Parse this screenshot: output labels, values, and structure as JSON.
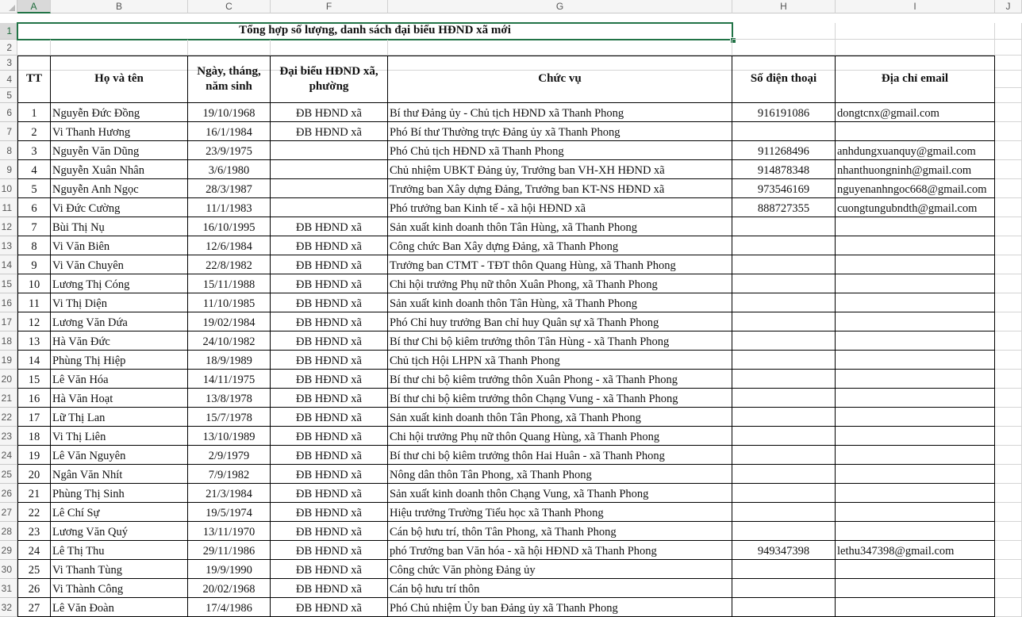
{
  "sheet": {
    "column_headers": [
      "A",
      "B",
      "C",
      "F",
      "G",
      "H",
      "I",
      "J"
    ],
    "selected_column": "A",
    "title": "Tổng hợp số lượng, danh sách đại biểu HĐND xã mới",
    "headers": {
      "tt": "TT",
      "name": "Họ và tên",
      "dob": "Ngày, tháng, năm sinh",
      "delegate": "Đại biểu HĐND xã, phường",
      "position": "Chức vụ",
      "phone": "Số điện thoại",
      "email": "Địa chỉ email"
    },
    "rows": [
      {
        "row": "6",
        "tt": "1",
        "name": "Nguyễn Đức Đồng",
        "dob": "19/10/1968",
        "delegate": "ĐB HĐND xã",
        "position": "Bí thư Đảng ủy - Chủ tịch HĐND xã Thanh Phong",
        "phone": "916191086",
        "email": "dongtcnx@gmail.com"
      },
      {
        "row": "7",
        "tt": "2",
        "name": "Vi Thanh Hương",
        "dob": "16/1/1984",
        "delegate": "ĐB HĐND xã",
        "position": "Phó Bí thư Thường trực Đảng ủy xã Thanh Phong",
        "phone": "",
        "email": ""
      },
      {
        "row": "8",
        "tt": "3",
        "name": "Nguyễn Văn Dũng",
        "dob": "23/9/1975",
        "delegate": "",
        "position": "Phó Chủ tịch HĐND xã Thanh Phong",
        "phone": "911268496",
        "email": "anhdungxuanquy@gmail.com"
      },
      {
        "row": "9",
        "tt": "4",
        "name": "Nguyễn Xuân Nhân",
        "dob": "3/6/1980",
        "delegate": "",
        "position": "Chủ nhiệm UBKT Đảng ủy, Trưởng ban VH-XH HĐND xã",
        "phone": "914878348",
        "email": "nhanthuongninh@gmail.com"
      },
      {
        "row": "10",
        "tt": "5",
        "name": "Nguyễn Anh Ngọc",
        "dob": "28/3/1987",
        "delegate": "",
        "position": "Trưởng ban Xây dựng Đảng, Trưởng ban KT-NS HĐND xã",
        "phone": "973546169",
        "email": "nguyenanhngoc668@gmail.com"
      },
      {
        "row": "11",
        "tt": "6",
        "name": "Vi Đức Cường",
        "dob": "11/1/1983",
        "delegate": "",
        "position": "Phó trưởng ban Kinh tế - xã hội HĐND xã",
        "phone": "888727355",
        "email": "cuongtungubndth@gmail.com"
      },
      {
        "row": "12",
        "tt": "7",
        "name": "Bùi Thị Nụ",
        "dob": "16/10/1995",
        "delegate": "ĐB HĐND xã",
        "position": "Sản xuất kinh doanh thôn Tân Hùng, xã Thanh Phong",
        "phone": "",
        "email": ""
      },
      {
        "row": "13",
        "tt": "8",
        "name": "Vi Văn Biên",
        "dob": "12/6/1984",
        "delegate": "ĐB HĐND xã",
        "position": "Công chức Ban Xây dựng Đảng, xã Thanh Phong",
        "phone": "",
        "email": ""
      },
      {
        "row": "14",
        "tt": "9",
        "name": "Vi Văn Chuyên",
        "dob": "22/8/1982",
        "delegate": "ĐB HĐND xã",
        "position": "Trưởng ban CTMT - TĐT thôn Quang Hùng, xã Thanh Phong",
        "phone": "",
        "email": ""
      },
      {
        "row": "15",
        "tt": "10",
        "name": "Lương Thị Cóng",
        "dob": "15/11/1988",
        "delegate": "ĐB HĐND xã",
        "position": "Chi hội trưởng Phụ nữ thôn Xuân Phong, xã Thanh Phong",
        "phone": "",
        "email": ""
      },
      {
        "row": "16",
        "tt": "11",
        "name": "Vi Thị Diện",
        "dob": "11/10/1985",
        "delegate": "ĐB HĐND xã",
        "position": "Sản xuất kinh doanh thôn Tân Hùng, xã Thanh Phong",
        "phone": "",
        "email": ""
      },
      {
        "row": "17",
        "tt": "12",
        "name": "Lương Văn Dứa",
        "dob": "19/02/1984",
        "delegate": "ĐB HĐND xã",
        "position": "Phó Chỉ huy trưởng Ban chỉ huy Quân sự xã Thanh Phong",
        "phone": "",
        "email": ""
      },
      {
        "row": "18",
        "tt": "13",
        "name": "Hà Văn Đức",
        "dob": "24/10/1982",
        "delegate": "ĐB HĐND xã",
        "position": "Bí thư Chi bộ kiêm trưởng thôn Tân Hùng - xã Thanh Phong",
        "phone": "",
        "email": ""
      },
      {
        "row": "19",
        "tt": "14",
        "name": "Phùng Thị Hiệp",
        "dob": "18/9/1989",
        "delegate": "ĐB HĐND xã",
        "position": "Chủ tịch Hội LHPN xã Thanh Phong",
        "phone": "",
        "email": ""
      },
      {
        "row": "20",
        "tt": "15",
        "name": "Lê Văn Hóa",
        "dob": "14/11/1975",
        "delegate": "ĐB HĐND xã",
        "position": "Bí thư chi bộ kiêm trưởng thôn Xuân Phong - xã Thanh Phong",
        "phone": "",
        "email": ""
      },
      {
        "row": "21",
        "tt": "16",
        "name": "Hà Văn Hoạt",
        "dob": "13/8/1978",
        "delegate": "ĐB HĐND xã",
        "position": "Bí thư chi bộ kiêm trưởng thôn Chạng Vung - xã Thanh Phong",
        "phone": "",
        "email": ""
      },
      {
        "row": "22",
        "tt": "17",
        "name": "Lữ Thị Lan",
        "dob": "15/7/1978",
        "delegate": "ĐB HĐND xã",
        "position": "Sản xuất kinh doanh thôn Tân Phong, xã Thanh Phong",
        "phone": "",
        "email": ""
      },
      {
        "row": "23",
        "tt": "18",
        "name": "Vi Thị Liên",
        "dob": "13/10/1989",
        "delegate": "ĐB HĐND xã",
        "position": "Chi hội trưởng Phụ nữ thôn Quang Hùng, xã Thanh Phong",
        "phone": "",
        "email": ""
      },
      {
        "row": "24",
        "tt": "19",
        "name": "Lê Văn Nguyên",
        "dob": "2/9/1979",
        "delegate": "ĐB HĐND xã",
        "position": "Bí thư chi bộ kiêm trưởng thôn Hai Huân - xã Thanh Phong",
        "phone": "",
        "email": ""
      },
      {
        "row": "25",
        "tt": "20",
        "name": "Ngân Văn Nhít",
        "dob": "7/9/1982",
        "delegate": "ĐB HĐND xã",
        "position": "Nông dân thôn Tân Phong, xã Thanh Phong",
        "phone": "",
        "email": ""
      },
      {
        "row": "26",
        "tt": "21",
        "name": "Phùng Thị Sinh",
        "dob": "21/3/1984",
        "delegate": "ĐB HĐND xã",
        "position": "Sản xuất kinh doanh thôn Chạng Vung, xã Thanh Phong",
        "phone": "",
        "email": ""
      },
      {
        "row": "27",
        "tt": "22",
        "name": "Lê Chí Sự",
        "dob": "19/5/1974",
        "delegate": "ĐB HĐND xã",
        "position": "Hiệu trưởng Trường Tiểu học xã Thanh Phong",
        "phone": "",
        "email": ""
      },
      {
        "row": "28",
        "tt": "23",
        "name": "Lương Văn Quý",
        "dob": "13/11/1970",
        "delegate": "ĐB HĐND xã",
        "position": "Cán bộ hưu trí, thôn Tân Phong, xã Thanh Phong",
        "phone": "",
        "email": ""
      },
      {
        "row": "29",
        "tt": "24",
        "name": "Lê Thị Thu",
        "dob": "29/11/1986",
        "delegate": "ĐB HĐND xã",
        "position": "phó Trưởng ban Văn hóa - xã hội HĐND xã Thanh Phong",
        "phone": "949347398",
        "email": "lethu347398@gmail.com"
      },
      {
        "row": "30",
        "tt": "25",
        "name": "Vi Thanh Tùng",
        "dob": "19/9/1990",
        "delegate": "ĐB HĐND xã",
        "position": "Công chức Văn phòng Đảng ủy",
        "phone": "",
        "email": ""
      },
      {
        "row": "31",
        "tt": "26",
        "name": "Vi Thành Công",
        "dob": "20/02/1968",
        "delegate": "ĐB HĐND xã",
        "position": "Cán bộ hưu trí thôn",
        "phone": "",
        "email": ""
      },
      {
        "row": "32",
        "tt": "27",
        "name": "Lê Văn Đoàn",
        "dob": "17/4/1986",
        "delegate": "ĐB HĐND xã",
        "position": "Phó Chủ nhiệm Ủy ban Đảng ủy xã Thanh Phong",
        "phone": "",
        "email": ""
      }
    ],
    "colors": {
      "accent": "#217346",
      "grid": "#d4d4d4",
      "header_bg": "#f5f5f5"
    }
  }
}
